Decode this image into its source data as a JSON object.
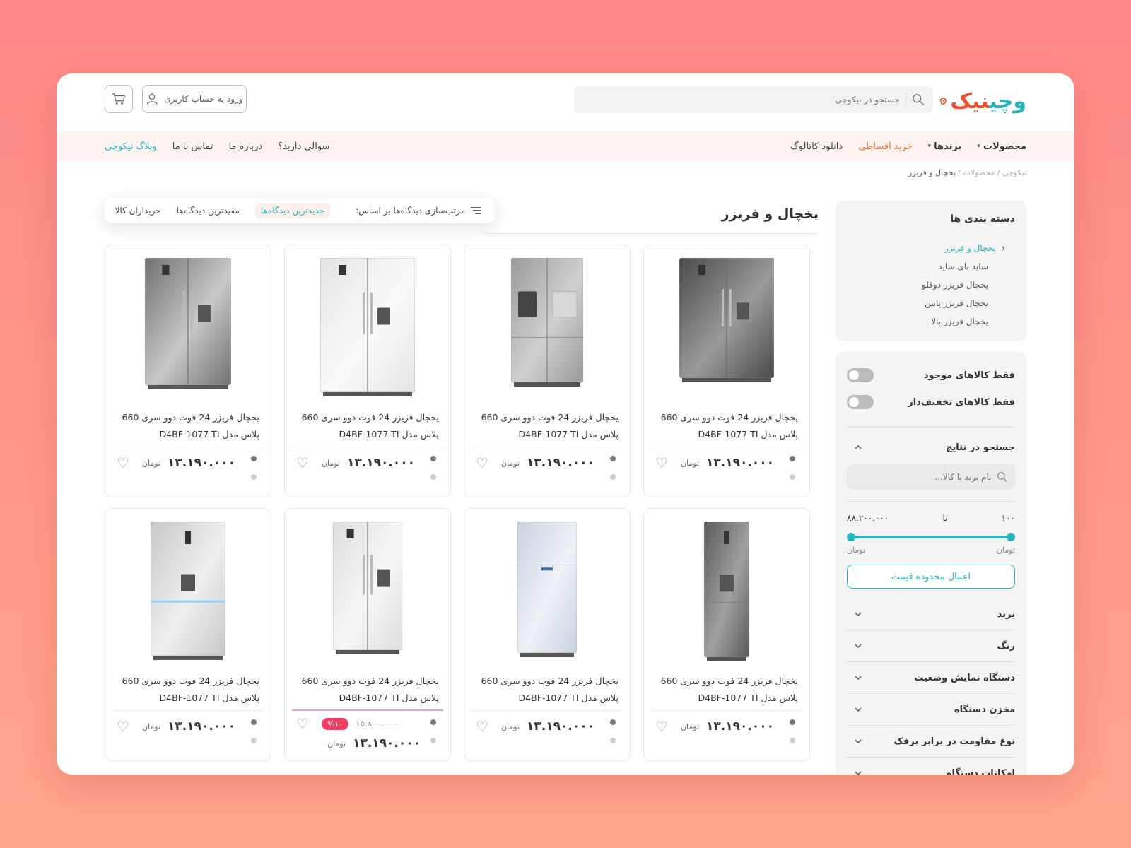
{
  "header": {
    "logo_part1": "نیک",
    "logo_part2": "وچی",
    "search_placeholder": "جستجو در نیکوچی",
    "login_label": "ورود به حساب کاربری"
  },
  "nav": {
    "right": [
      {
        "label": "محصولات",
        "style": "bold",
        "dropdown": true
      },
      {
        "label": "برندها",
        "style": "bold",
        "dropdown": true
      },
      {
        "label": "خرید اقساطی",
        "style": "orange",
        "dropdown": false
      },
      {
        "label": "دانلود کاتالوگ",
        "style": "normal",
        "dropdown": false
      }
    ],
    "left": [
      {
        "label": "سوالی دارید؟",
        "style": "normal"
      },
      {
        "label": "درباره ما",
        "style": "normal"
      },
      {
        "label": "تماس با ما",
        "style": "normal"
      },
      {
        "label": "وبلاگ نیکوچی",
        "style": "teal"
      }
    ]
  },
  "breadcrumb": {
    "items": [
      "نیکوچی",
      "محصولات"
    ],
    "current": "یخچال و فریزر"
  },
  "sidebar": {
    "categories_title": "دسته بندی ها",
    "categories": [
      {
        "label": "یخچال و فریزر",
        "active": true
      },
      {
        "label": "ساید بای ساید",
        "active": false
      },
      {
        "label": "یخچال فریزر دوقلو",
        "active": false
      },
      {
        "label": "یخچال فریزر پایین",
        "active": false
      },
      {
        "label": "یخچال فریزر بالا",
        "active": false
      }
    ],
    "toggles": [
      "فقط کالاهای موجود",
      "فقط کالاهای تخفیف‌دار"
    ],
    "search_section_title": "جستجو در نتایج",
    "search_placeholder": "نام برند یا کالا...",
    "range_min": "۱۰۰",
    "range_max": "۸۸.۲۰۰.۰۰۰",
    "range_to": "تا",
    "unit": "تومان",
    "apply_label": "اعمال محدوده قیمت",
    "accordions": [
      "برند",
      "رنگ",
      "دستگاه نمایش وضعیت",
      "مخزن دستگاه",
      "نوع مقاومت در برابر برفک",
      "امکانات دستگاه"
    ]
  },
  "main": {
    "title": "یخچال و فریزر",
    "sort_label": "مرتب‌سازی دیدگاه‌ها بر اساس:",
    "sort_options": [
      {
        "label": "جدیدترین دیدگاه‌ها",
        "active": true
      },
      {
        "label": "مفیدترین دیدگاه‌ها",
        "active": false
      },
      {
        "label": "خریداران کالا",
        "active": false
      }
    ]
  },
  "products": [
    {
      "name": "یخچال فریزر 24 فوت دوو سری 660 پلاس مدل D4BF-1077 TI",
      "price": "۱۳.۱۹۰.۰۰۰",
      "currency": "تومان",
      "old_price": "",
      "discount": "",
      "colors": [
        "#777777",
        "#cccccc"
      ],
      "style": "dark-sxs"
    },
    {
      "name": "یخچال فریزر 24 فوت دوو سری 660 پلاس مدل D4BF-1077 TI",
      "price": "۱۳.۱۹۰.۰۰۰",
      "currency": "تومان",
      "old_price": "",
      "discount": "",
      "colors": [
        "#777777",
        "#cccccc"
      ],
      "style": "silver-4door"
    },
    {
      "name": "یخچال فریزر 24 فوت دوو سری 660 پلاس مدل D4BF-1077 TI",
      "price": "۱۳.۱۹۰.۰۰۰",
      "currency": "تومان",
      "old_price": "",
      "discount": "",
      "colors": [
        "#777777",
        "#cccccc"
      ],
      "style": "white-twin"
    },
    {
      "name": "یخچال فریزر 24 فوت دوو سری 660 پلاس مدل D4BF-1077 TI",
      "price": "۱۳.۱۹۰.۰۰۰",
      "currency": "تومان",
      "old_price": "",
      "discount": "",
      "colors": [
        "#777777",
        "#cccccc"
      ],
      "style": "steel-twin"
    },
    {
      "name": "یخچال فریزر 24 فوت دوو سری 660 پلاس مدل D4BF-1077 TI",
      "price": "۱۳.۱۹۰.۰۰۰",
      "currency": "تومان",
      "old_price": "",
      "discount": "",
      "colors": [
        "#777777",
        "#cccccc"
      ],
      "style": "dark-bottom"
    },
    {
      "name": "یخچال فریزر 24 فوت دوو سری 660 پلاس مدل D4BF-1077 TI",
      "price": "۱۳.۱۹۰.۰۰۰",
      "currency": "تومان",
      "old_price": "",
      "discount": "",
      "colors": [
        "#777777",
        "#cccccc"
      ],
      "style": "white-top"
    },
    {
      "name": "یخچال فریزر 24 فوت دوو سری 660 پلاس مدل D4BF-1077 TI",
      "price": "۱۳.۱۹۰.۰۰۰",
      "currency": "تومان",
      "old_price": "۱۵.۸۰۰.۰۰۰",
      "discount": "%۱۰",
      "colors": [
        "#777777",
        "#cccccc"
      ],
      "style": "white-sxs"
    },
    {
      "name": "یخچال فریزر 24 فوت دوو سری 660 پلاس مدل D4BF-1077 TI",
      "price": "۱۳.۱۹۰.۰۰۰",
      "currency": "تومان",
      "old_price": "",
      "discount": "",
      "colors": [
        "#777777",
        "#cccccc"
      ],
      "style": "light-bottom"
    }
  ],
  "theme": {
    "accent_teal": "#23b5bb",
    "accent_orange": "#e8542e",
    "discount_pink": "#f23e64"
  }
}
